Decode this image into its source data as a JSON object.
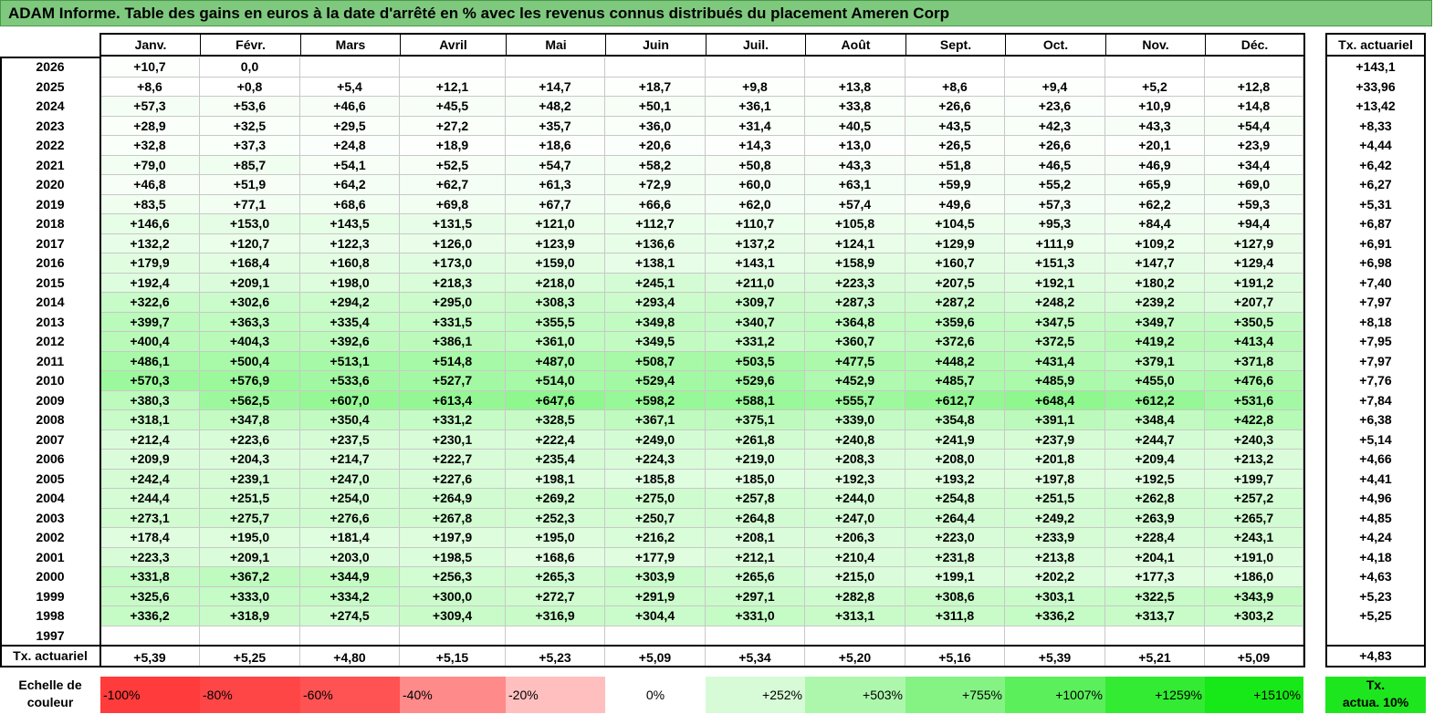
{
  "title": "ADAM Informe. Table des gains en euros à la date d'arrêté en % avec les revenus connus distribués du placement Ameren Corp",
  "months": [
    "Janv.",
    "Févr.",
    "Mars",
    "Avril",
    "Mai",
    "Juin",
    "Juil.",
    "Août",
    "Sept.",
    "Oct.",
    "Nov.",
    "Déc."
  ],
  "rate_header": "Tx. actuariel",
  "rows": [
    {
      "year": "2026",
      "values": [
        "+10,7",
        "0,0",
        "",
        "",
        "",
        "",
        "",
        "",
        "",
        "",
        "",
        ""
      ],
      "rate": "+143,1"
    },
    {
      "year": "2025",
      "values": [
        "+8,6",
        "+0,8",
        "+5,4",
        "+12,1",
        "+14,7",
        "+18,7",
        "+9,8",
        "+13,8",
        "+8,6",
        "+9,4",
        "+5,2",
        "+12,8"
      ],
      "rate": "+33,96"
    },
    {
      "year": "2024",
      "values": [
        "+57,3",
        "+53,6",
        "+46,6",
        "+45,5",
        "+48,2",
        "+50,1",
        "+36,1",
        "+33,8",
        "+26,6",
        "+23,6",
        "+10,9",
        "+14,8"
      ],
      "rate": "+13,42"
    },
    {
      "year": "2023",
      "values": [
        "+28,9",
        "+32,5",
        "+29,5",
        "+27,2",
        "+35,7",
        "+36,0",
        "+31,4",
        "+40,5",
        "+43,5",
        "+42,3",
        "+43,3",
        "+54,4"
      ],
      "rate": "+8,33"
    },
    {
      "year": "2022",
      "values": [
        "+32,8",
        "+37,3",
        "+24,8",
        "+18,9",
        "+18,6",
        "+20,6",
        "+14,3",
        "+13,0",
        "+26,5",
        "+26,6",
        "+20,1",
        "+23,9"
      ],
      "rate": "+4,44"
    },
    {
      "year": "2021",
      "values": [
        "+79,0",
        "+85,7",
        "+54,1",
        "+52,5",
        "+54,7",
        "+58,2",
        "+50,8",
        "+43,3",
        "+51,8",
        "+46,5",
        "+46,9",
        "+34,4"
      ],
      "rate": "+6,42"
    },
    {
      "year": "2020",
      "values": [
        "+46,8",
        "+51,9",
        "+64,2",
        "+62,7",
        "+61,3",
        "+72,9",
        "+60,0",
        "+63,1",
        "+59,9",
        "+55,2",
        "+65,9",
        "+69,0"
      ],
      "rate": "+6,27"
    },
    {
      "year": "2019",
      "values": [
        "+83,5",
        "+77,1",
        "+68,6",
        "+69,8",
        "+67,7",
        "+66,6",
        "+62,0",
        "+57,4",
        "+49,6",
        "+57,3",
        "+62,2",
        "+59,3"
      ],
      "rate": "+5,31"
    },
    {
      "year": "2018",
      "values": [
        "+146,6",
        "+153,0",
        "+143,5",
        "+131,5",
        "+121,0",
        "+112,7",
        "+110,7",
        "+105,8",
        "+104,5",
        "+95,3",
        "+84,4",
        "+94,4"
      ],
      "rate": "+6,87"
    },
    {
      "year": "2017",
      "values": [
        "+132,2",
        "+120,7",
        "+122,3",
        "+126,0",
        "+123,9",
        "+136,6",
        "+137,2",
        "+124,1",
        "+129,9",
        "+111,9",
        "+109,2",
        "+127,9"
      ],
      "rate": "+6,91"
    },
    {
      "year": "2016",
      "values": [
        "+179,9",
        "+168,4",
        "+160,8",
        "+173,0",
        "+159,0",
        "+138,1",
        "+143,1",
        "+158,9",
        "+160,7",
        "+151,3",
        "+147,7",
        "+129,4"
      ],
      "rate": "+6,98"
    },
    {
      "year": "2015",
      "values": [
        "+192,4",
        "+209,1",
        "+198,0",
        "+218,3",
        "+218,0",
        "+245,1",
        "+211,0",
        "+223,3",
        "+207,5",
        "+192,1",
        "+180,2",
        "+191,2"
      ],
      "rate": "+7,40"
    },
    {
      "year": "2014",
      "values": [
        "+322,6",
        "+302,6",
        "+294,2",
        "+295,0",
        "+308,3",
        "+293,4",
        "+309,7",
        "+287,3",
        "+287,2",
        "+248,2",
        "+239,2",
        "+207,7"
      ],
      "rate": "+7,97"
    },
    {
      "year": "2013",
      "values": [
        "+399,7",
        "+363,3",
        "+335,4",
        "+331,5",
        "+355,5",
        "+349,8",
        "+340,7",
        "+364,8",
        "+359,6",
        "+347,5",
        "+349,7",
        "+350,5"
      ],
      "rate": "+8,18"
    },
    {
      "year": "2012",
      "values": [
        "+400,4",
        "+404,3",
        "+392,6",
        "+386,1",
        "+361,0",
        "+349,5",
        "+331,2",
        "+360,7",
        "+372,6",
        "+372,5",
        "+419,2",
        "+413,4"
      ],
      "rate": "+7,95"
    },
    {
      "year": "2011",
      "values": [
        "+486,1",
        "+500,4",
        "+513,1",
        "+514,8",
        "+487,0",
        "+508,7",
        "+503,5",
        "+477,5",
        "+448,2",
        "+431,4",
        "+379,1",
        "+371,8"
      ],
      "rate": "+7,97"
    },
    {
      "year": "2010",
      "values": [
        "+570,3",
        "+576,9",
        "+533,6",
        "+527,7",
        "+514,0",
        "+529,4",
        "+529,6",
        "+452,9",
        "+485,7",
        "+485,9",
        "+455,0",
        "+476,6"
      ],
      "rate": "+7,76"
    },
    {
      "year": "2009",
      "values": [
        "+380,3",
        "+562,5",
        "+607,0",
        "+613,4",
        "+647,6",
        "+598,2",
        "+588,1",
        "+555,7",
        "+612,7",
        "+648,4",
        "+612,2",
        "+531,6"
      ],
      "rate": "+7,84"
    },
    {
      "year": "2008",
      "values": [
        "+318,1",
        "+347,8",
        "+350,4",
        "+331,2",
        "+328,5",
        "+367,1",
        "+375,1",
        "+339,0",
        "+354,8",
        "+391,1",
        "+348,4",
        "+422,8"
      ],
      "rate": "+6,38"
    },
    {
      "year": "2007",
      "values": [
        "+212,4",
        "+223,6",
        "+237,5",
        "+230,1",
        "+222,4",
        "+249,0",
        "+261,8",
        "+240,8",
        "+241,9",
        "+237,9",
        "+244,7",
        "+240,3"
      ],
      "rate": "+5,14"
    },
    {
      "year": "2006",
      "values": [
        "+209,9",
        "+204,3",
        "+214,7",
        "+222,7",
        "+235,4",
        "+224,3",
        "+219,0",
        "+208,3",
        "+208,0",
        "+201,8",
        "+209,4",
        "+213,2"
      ],
      "rate": "+4,66"
    },
    {
      "year": "2005",
      "values": [
        "+242,4",
        "+239,1",
        "+247,0",
        "+227,6",
        "+198,1",
        "+185,8",
        "+185,0",
        "+192,3",
        "+193,2",
        "+197,8",
        "+192,5",
        "+199,7"
      ],
      "rate": "+4,41"
    },
    {
      "year": "2004",
      "values": [
        "+244,4",
        "+251,5",
        "+254,0",
        "+264,9",
        "+269,2",
        "+275,0",
        "+257,8",
        "+244,0",
        "+254,8",
        "+251,5",
        "+262,8",
        "+257,2"
      ],
      "rate": "+4,96"
    },
    {
      "year": "2003",
      "values": [
        "+273,1",
        "+275,7",
        "+276,6",
        "+267,8",
        "+252,3",
        "+250,7",
        "+264,8",
        "+247,0",
        "+264,4",
        "+249,2",
        "+263,9",
        "+265,7"
      ],
      "rate": "+4,85"
    },
    {
      "year": "2002",
      "values": [
        "+178,4",
        "+195,0",
        "+181,4",
        "+197,9",
        "+195,0",
        "+216,2",
        "+208,1",
        "+206,3",
        "+223,0",
        "+233,9",
        "+228,4",
        "+243,1"
      ],
      "rate": "+4,24"
    },
    {
      "year": "2001",
      "values": [
        "+223,3",
        "+209,1",
        "+203,0",
        "+198,5",
        "+168,6",
        "+177,9",
        "+212,1",
        "+210,4",
        "+231,8",
        "+213,8",
        "+204,1",
        "+191,0"
      ],
      "rate": "+4,18"
    },
    {
      "year": "2000",
      "values": [
        "+331,8",
        "+367,2",
        "+344,9",
        "+256,3",
        "+265,3",
        "+303,9",
        "+265,6",
        "+215,0",
        "+199,1",
        "+202,2",
        "+177,3",
        "+186,0"
      ],
      "rate": "+4,63"
    },
    {
      "year": "1999",
      "values": [
        "+325,6",
        "+333,0",
        "+334,2",
        "+300,0",
        "+272,7",
        "+291,9",
        "+297,1",
        "+282,8",
        "+308,6",
        "+303,1",
        "+322,5",
        "+343,9"
      ],
      "rate": "+5,23"
    },
    {
      "year": "1998",
      "values": [
        "+336,2",
        "+318,9",
        "+274,5",
        "+309,4",
        "+316,9",
        "+304,4",
        "+331,0",
        "+313,1",
        "+311,8",
        "+336,2",
        "+313,7",
        "+303,2"
      ],
      "rate": "+5,25"
    },
    {
      "year": "1997",
      "values": [
        "",
        "",
        "",
        "",
        "",
        "",
        "",
        "",
        "",
        "",
        "",
        ""
      ],
      "rate": ""
    }
  ],
  "tx_row": {
    "label": "Tx. actuariel",
    "values": [
      "+5,39",
      "+5,25",
      "+4,80",
      "+5,15",
      "+5,23",
      "+5,09",
      "+5,34",
      "+5,20",
      "+5,16",
      "+5,39",
      "+5,21",
      "+5,09"
    ],
    "rate": "+4,83"
  },
  "scale": {
    "label_line1": "Echelle de",
    "label_line2": "couleur",
    "steps": [
      {
        "label": "-100%",
        "color": "#ff3b3b",
        "align": "left"
      },
      {
        "label": "-80%",
        "color": "#ff4646",
        "align": "left"
      },
      {
        "label": "-60%",
        "color": "#ff5252",
        "align": "left"
      },
      {
        "label": "-40%",
        "color": "#ff8a8a",
        "align": "left"
      },
      {
        "label": "-20%",
        "color": "#ffbfbf",
        "align": "left"
      },
      {
        "label": "0%",
        "color": "#ffffff",
        "align": "center"
      },
      {
        "label": "+252%",
        "color": "#d6fbd6",
        "align": "right"
      },
      {
        "label": "+503%",
        "color": "#adf7ad",
        "align": "right"
      },
      {
        "label": "+755%",
        "color": "#84f384",
        "align": "right"
      },
      {
        "label": "+1007%",
        "color": "#5bef5b",
        "align": "right"
      },
      {
        "label": "+1259%",
        "color": "#33eb33",
        "align": "right"
      },
      {
        "label": "+1510%",
        "color": "#17e817",
        "align": "right"
      }
    ],
    "rate_label_line1": "Tx.",
    "rate_label_line2": "actua. 10%",
    "rate_color": "#1ee61e"
  },
  "colors": {
    "title_bg": "#7fc97f",
    "positive_low": "#ffffff",
    "positive_high": "#8ef78e"
  }
}
